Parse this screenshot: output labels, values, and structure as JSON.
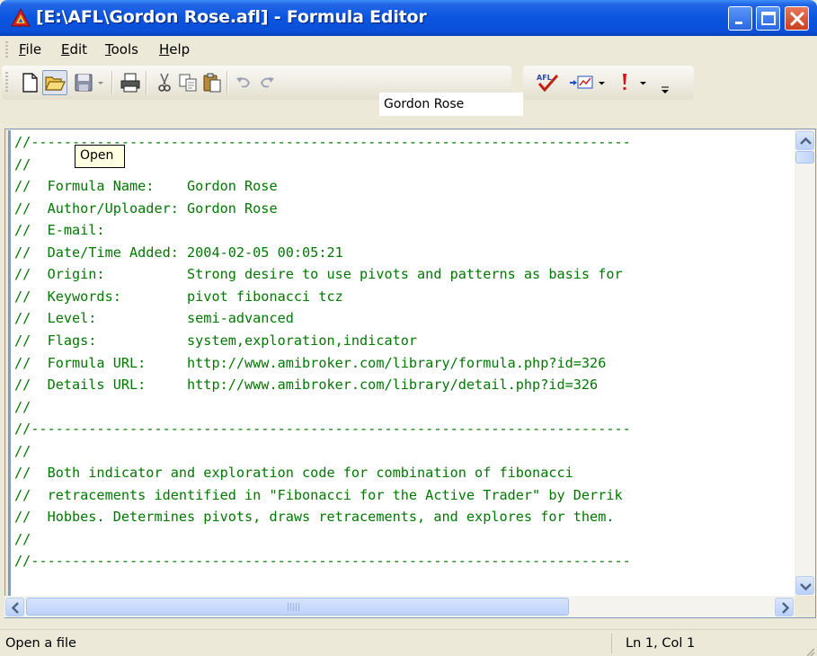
{
  "window": {
    "title": "[E:\\AFL\\Gordon Rose.afl] - Formula Editor"
  },
  "menu": {
    "items": [
      {
        "label": "File"
      },
      {
        "label": "Edit"
      },
      {
        "label": "Tools"
      },
      {
        "label": "Help"
      }
    ]
  },
  "toolbar": {
    "formula_name": "Gordon Rose",
    "icons": [
      "new-file-icon",
      "open-folder-icon",
      "save-icon",
      "print-icon",
      "cut-icon",
      "copy-icon",
      "paste-icon",
      "undo-icon",
      "redo-icon",
      "afl-check-icon",
      "apply-indicator-icon",
      "run-icon"
    ]
  },
  "tooltip": {
    "text": "Open"
  },
  "editor": {
    "text_color": "#007800",
    "lines": [
      "//-------------------------------------------------------------------------",
      "//",
      "//  Formula Name:    Gordon Rose",
      "//  Author/Uploader: Gordon Rose",
      "//  E-mail:",
      "//  Date/Time Added: 2004-02-05 00:05:21",
      "//  Origin:          Strong desire to use pivots and patterns as basis for",
      "//  Keywords:        pivot fibonacci tcz",
      "//  Level:           semi-advanced",
      "//  Flags:           system,exploration,indicator",
      "//  Formula URL:     http://www.amibroker.com/library/formula.php?id=326",
      "//  Details URL:     http://www.amibroker.com/library/detail.php?id=326",
      "//",
      "//-------------------------------------------------------------------------",
      "//",
      "//  Both indicator and exploration code for combination of fibonacci",
      "//  retracements identified in \"Fibonacci for the Active Trader\" by Derrik",
      "//  Hobbes. Determines pivots, draws retracements, and explores for them.",
      "//",
      "//-------------------------------------------------------------------------"
    ]
  },
  "status": {
    "message": "Open a file",
    "position": "Ln 1, Col 1"
  },
  "colors": {
    "titlebar": "#0a55e0",
    "chrome": "#ece9d8",
    "code": "#007800"
  }
}
